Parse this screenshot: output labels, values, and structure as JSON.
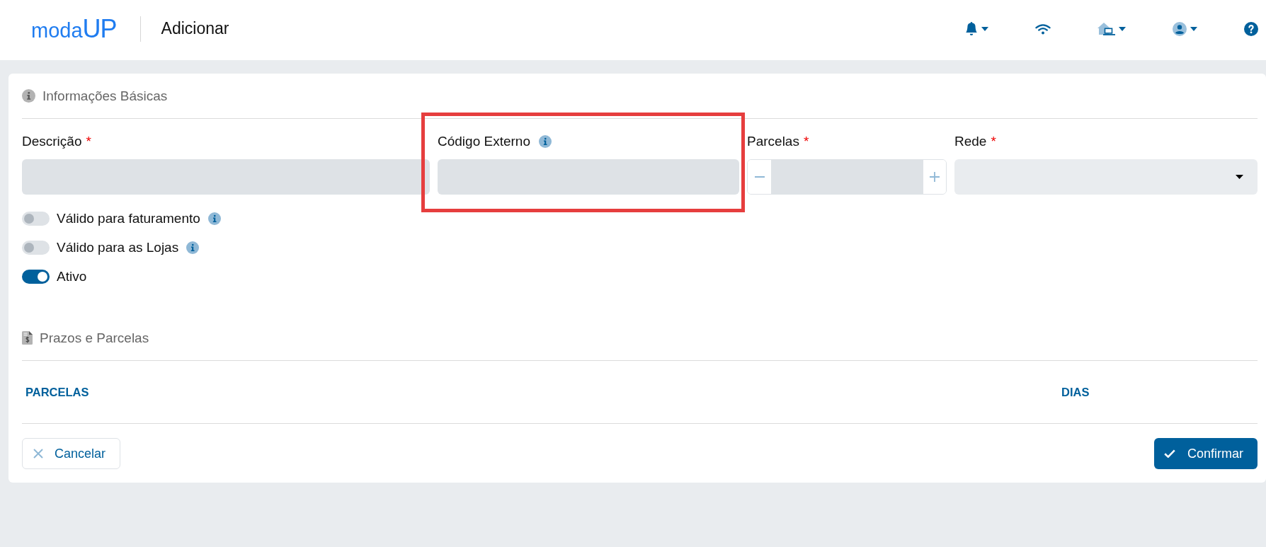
{
  "header": {
    "logo": {
      "prefix": "moda",
      "suffix": "UP"
    },
    "title": "Adicionar",
    "actions": [
      {
        "kind": "notifications",
        "dropdown": true
      },
      {
        "kind": "connection"
      },
      {
        "kind": "location",
        "dropdown": true
      },
      {
        "kind": "account",
        "dropdown": true
      },
      {
        "kind": "help"
      }
    ]
  },
  "basic_info": {
    "title": "Informações Básicas",
    "fields": [
      {
        "kind": "text",
        "label": "Descrição",
        "required_mark": "*"
      },
      {
        "kind": "text",
        "label": "Código Externo",
        "info": true,
        "highlighted": true
      },
      {
        "kind": "stepper",
        "label": "Parcelas",
        "required_mark": "*"
      },
      {
        "kind": "select",
        "label": "Rede",
        "required_mark": "*"
      }
    ],
    "toggles": [
      {
        "label": "Válido para faturamento",
        "on": false,
        "info": true
      },
      {
        "label": "Válido para as Lojas",
        "on": false,
        "info": true
      },
      {
        "label": "Ativo",
        "on": true
      }
    ]
  },
  "installments": {
    "title": "Prazos e Parcelas",
    "columns": [
      "PARCELAS",
      "DIAS"
    ]
  },
  "buttons": [
    {
      "kind": "cancel",
      "label": "Cancelar"
    },
    {
      "kind": "confirm",
      "label": "Confirmar"
    }
  ]
}
